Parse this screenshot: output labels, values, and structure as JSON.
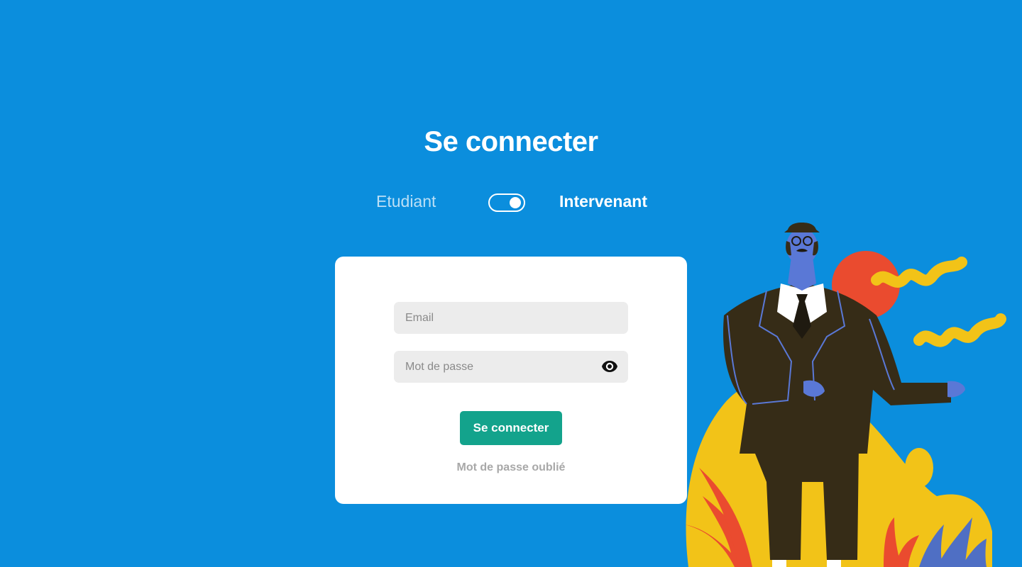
{
  "title": "Se connecter",
  "role_switch": {
    "left_label": "Etudiant",
    "right_label": "Intervenant",
    "selected": "Intervenant"
  },
  "form": {
    "email_placeholder": "Email",
    "email_value": "",
    "password_placeholder": "Mot de passe",
    "password_value": "",
    "submit_label": "Se connecter",
    "forgot_label": "Mot de passe oublié"
  },
  "icons": {
    "password_toggle": "eye-icon"
  },
  "colors": {
    "background": "#0b8edd",
    "button": "#13a38c",
    "field": "#ececec"
  }
}
